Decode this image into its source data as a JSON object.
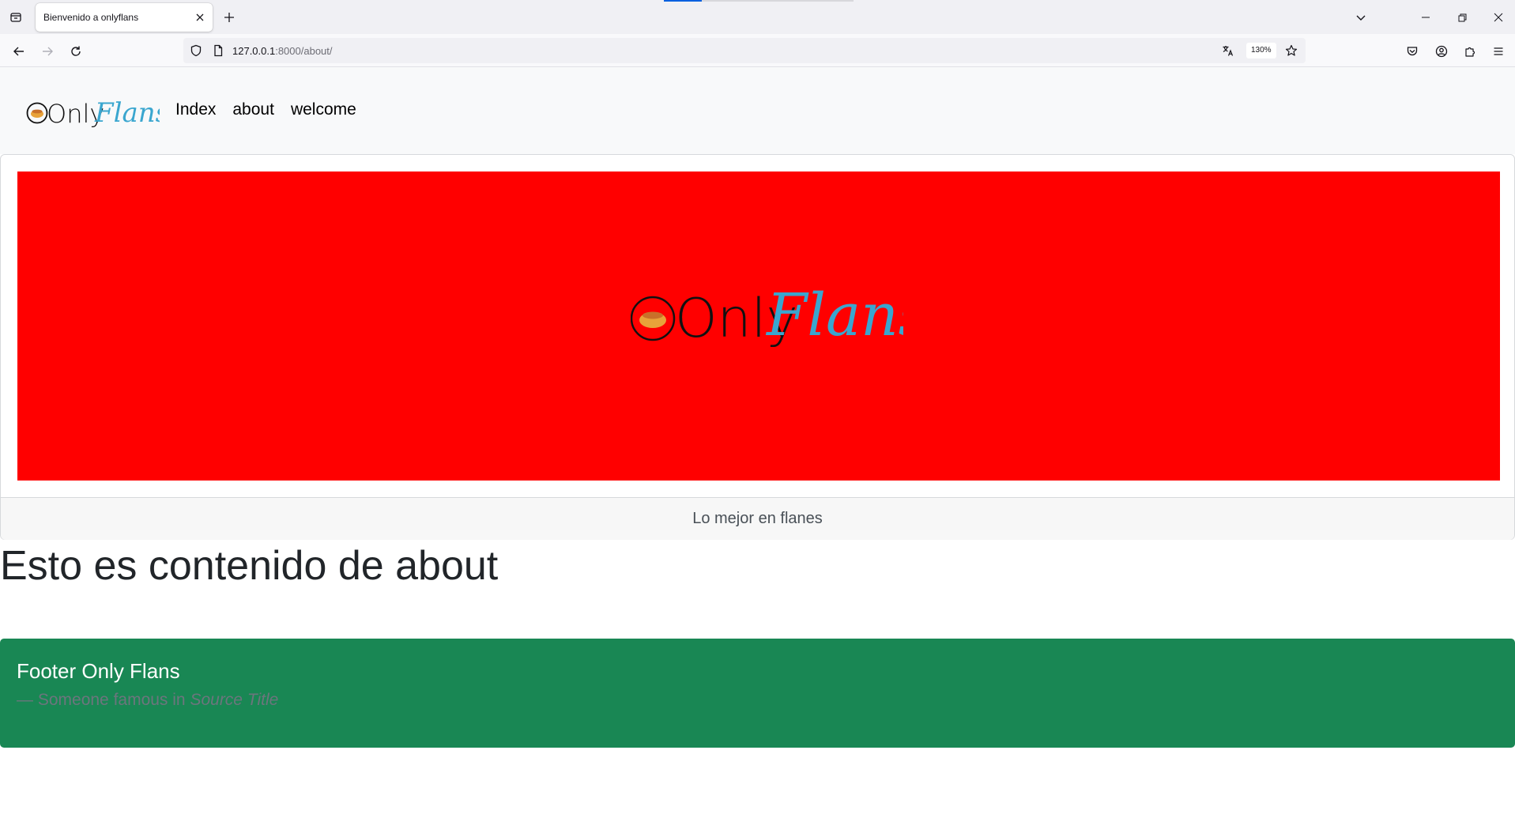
{
  "browser": {
    "tab_title": "Bienvenido a onlyflans",
    "url_host": "127.0.0.1",
    "url_path": ":8000/about/",
    "zoom": "130%"
  },
  "site": {
    "brand_only": "Only",
    "brand_flans": "Flans",
    "nav": {
      "index": "Index",
      "about": "about",
      "welcome": "welcome"
    }
  },
  "card": {
    "banner_color": "#ff0000",
    "footer_text": "Lo mejor en flanes"
  },
  "main": {
    "heading": "Esto es contenido de about"
  },
  "footer": {
    "title": "Footer Only Flans",
    "cite_prefix": "— Someone famous in ",
    "cite_source": "Source Title",
    "color": "#198754"
  },
  "colors": {
    "brand_blue": "#3aa6cf",
    "flan_orange": "#e8a23a"
  }
}
